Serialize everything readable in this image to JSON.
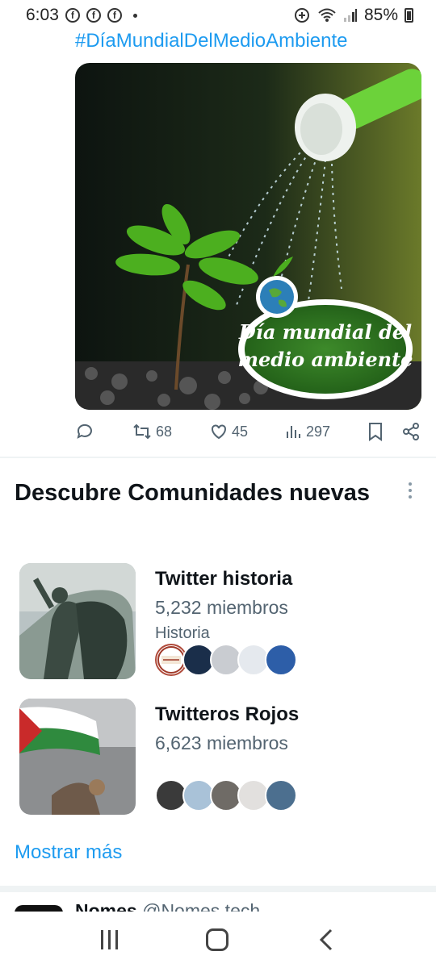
{
  "status_bar": {
    "time": "6:03",
    "notification_icons": [
      "f",
      "f",
      "f"
    ],
    "battery": "85%"
  },
  "tweet": {
    "hashtag": "#DíaMundialDelMedioAmbiente",
    "image": {
      "badge_line1": "Día mundial del",
      "badge_line2": "medio ambiente"
    },
    "actions": {
      "retweets": "68",
      "likes": "45",
      "views": "297"
    }
  },
  "communities": {
    "title": "Descubre Comunidades nuevas",
    "items": [
      {
        "name": "Twitter historia",
        "members": "5,232 miembros",
        "topic": "Historia",
        "facepile_first_label": "ANTIGUA ROMA AL DIA"
      },
      {
        "name": "Twitteros Rojos",
        "members": "6,623 miembros",
        "topic": ""
      }
    ],
    "show_more": "Mostrar más"
  },
  "next_tweet": {
    "name": "Nomes",
    "handle": "@Nomes.tech"
  },
  "colors": {
    "accent": "#1d9bf0",
    "text_primary": "#0f1419",
    "text_secondary": "#536471"
  }
}
